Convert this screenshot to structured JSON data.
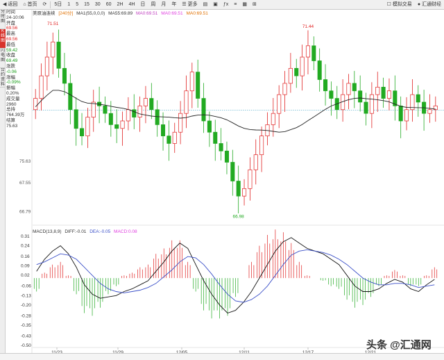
{
  "toolbar": {
    "items": [
      "返回",
      "首页",
      "",
      "5日",
      "1",
      "5",
      "15",
      "30",
      "60",
      "2H",
      "4H",
      "日",
      "周",
      "月",
      "年",
      "更多",
      "",
      "",
      "",
      "",
      "",
      "",
      "",
      ""
    ],
    "back": "返回",
    "home": "首页",
    "periods": [
      "5日",
      "1",
      "5",
      "15",
      "30",
      "60",
      "2H",
      "4H",
      "日",
      "周",
      "月",
      "年",
      "更多"
    ],
    "active_period": "",
    "tick": "tick",
    "sim_trade": "模拟交易",
    "finance": "汇通财经"
  },
  "sidebar": {
    "tabs": [
      "分时图",
      "K线图",
      "闪电图",
      "合约资料"
    ],
    "active": 1
  },
  "info": {
    "time_label": "时间",
    "time_value": "24-10:06",
    "open_label": "开盘",
    "open_value": "69.56",
    "high_label": "最高",
    "high_value": "69.56",
    "low_label": "最低",
    "low_value": "59.42",
    "close_label": "收盘",
    "close_value": "69.49",
    "change_label": "涨跌",
    "change_value": "-0.06",
    "pct_label": "涨幅",
    "pct_value": "-0.09%",
    "amp_label": "振幅",
    "amp_value": "0.20%",
    "vol_label": "成交量",
    "vol_value": "2960",
    "oi_label": "总持",
    "oi_value": "764.39万",
    "settle_label": "结算",
    "settle_value": "75.63"
  },
  "chart_head": {
    "name": "美原油连续",
    "period": "[240分]",
    "ma1": "MA1(55,0,0,0)",
    "ma55": "MA55:69.89",
    "ma0a": "MA0:69.51",
    "ma0b": "MA0:69.51",
    "ma0c": "MA0:69.51"
  },
  "macd_head": {
    "label": "MACD(13,8,9)",
    "diff": "DIFF:-0.01",
    "dea": "DEA:-0.05",
    "macd": "MACD:0.08"
  },
  "watermark": "头条 @汇通网",
  "chart_data": [
    {
      "type": "candlestick",
      "title": "",
      "y_ticks": [
        75.63,
        67.55,
        66.79
      ],
      "y_tick_labels": [
        "75.63",
        "67.55",
        "66.79"
      ],
      "x_labels": [
        "11/23",
        "11/29",
        "12/05",
        "12/11",
        "12/17",
        "12/21"
      ],
      "annotations": [
        {
          "text": "71.51",
          "near": "first peak"
        },
        {
          "text": "71.44",
          "near": "second peak"
        },
        {
          "text": "66.98",
          "near": "trough"
        }
      ],
      "current_price_line": 69.49,
      "ma55_series_name": "MA55",
      "closes": [
        69.8,
        70.4,
        70.9,
        71.3,
        70.6,
        70.2,
        69.5,
        69.0,
        68.8,
        69.3,
        69.7,
        69.6,
        69.4,
        69.1,
        69.0,
        69.2,
        69.5,
        69.3,
        69.6,
        69.8,
        69.5,
        69.1,
        68.8,
        68.6,
        68.9,
        69.4,
        70.0,
        70.5,
        69.8,
        69.2,
        68.9,
        68.6,
        68.4,
        68.1,
        67.6,
        67.2,
        67.4,
        67.9,
        68.3,
        68.8,
        69.1,
        69.4,
        69.9,
        70.2,
        70.6,
        70.4,
        70.9,
        71.2,
        70.8,
        70.3,
        70.0,
        69.8,
        69.5,
        69.9,
        70.2,
        70.0,
        69.7,
        69.4,
        69.9,
        70.1,
        69.8,
        70.0,
        69.6,
        69.2,
        69.5,
        69.9,
        69.7,
        69.4,
        69.5,
        69.6
      ]
    },
    {
      "type": "bar",
      "title": "",
      "y_tick_labels": [
        "0.31",
        "0.24",
        "0.16",
        "0.09",
        "0.02",
        "-0.06",
        "-0.13",
        "-0.20",
        "-0.28",
        "-0.35",
        "-0.43",
        "-0.50"
      ],
      "ylim": [
        -0.5,
        0.31
      ],
      "series": [
        {
          "name": "DIFF",
          "values": [
            0.05,
            0.14,
            0.2,
            0.24,
            0.18,
            0.08,
            -0.05,
            -0.12,
            -0.15,
            -0.14,
            -0.13,
            -0.1,
            -0.08,
            -0.05,
            -0.02,
            0.05,
            0.12,
            0.2,
            0.26,
            0.22,
            0.1,
            -0.02,
            -0.12,
            -0.2,
            -0.26,
            -0.24,
            -0.18,
            -0.1,
            0.0,
            0.1,
            0.2,
            0.27,
            0.3,
            0.26,
            0.22,
            0.2,
            0.18,
            0.14,
            0.1,
            0.02,
            -0.06,
            -0.1,
            -0.1,
            -0.08,
            -0.04,
            -0.01,
            -0.03,
            -0.08,
            -0.1,
            -0.05,
            -0.01
          ]
        },
        {
          "name": "DEA",
          "values": [
            0.1,
            0.12,
            0.15,
            0.18,
            0.17,
            0.14,
            0.08,
            0.02,
            -0.04,
            -0.08,
            -0.1,
            -0.11,
            -0.1,
            -0.09,
            -0.07,
            -0.04,
            0.01,
            0.06,
            0.12,
            0.16,
            0.15,
            0.1,
            0.03,
            -0.05,
            -0.12,
            -0.17,
            -0.18,
            -0.16,
            -0.12,
            -0.06,
            0.02,
            0.1,
            0.17,
            0.2,
            0.21,
            0.2,
            0.19,
            0.17,
            0.14,
            0.1,
            0.05,
            0.0,
            -0.03,
            -0.05,
            -0.05,
            -0.04,
            -0.04,
            -0.05,
            -0.07,
            -0.06,
            -0.05
          ]
        },
        {
          "name": "MACD",
          "values": [
            -0.1,
            0.04,
            0.1,
            0.12,
            0.02,
            -0.12,
            -0.26,
            -0.28,
            -0.22,
            -0.12,
            -0.06,
            0.02,
            0.04,
            0.08,
            0.1,
            0.18,
            0.22,
            0.28,
            0.28,
            0.12,
            -0.1,
            -0.24,
            -0.3,
            -0.3,
            -0.28,
            -0.14,
            0.0,
            0.12,
            0.24,
            0.32,
            0.36,
            0.34,
            0.26,
            0.12,
            0.02,
            0.0,
            -0.02,
            -0.06,
            -0.08,
            -0.16,
            -0.22,
            -0.2,
            -0.14,
            -0.06,
            0.02,
            0.06,
            0.02,
            -0.06,
            -0.06,
            0.02,
            0.08
          ]
        }
      ]
    }
  ],
  "colors": {
    "up": "#e02020",
    "down": "#22aa22",
    "ma": "#222222",
    "diff": "#111111",
    "dea": "#3a4fc8",
    "price_line": "#4aa8c8"
  }
}
